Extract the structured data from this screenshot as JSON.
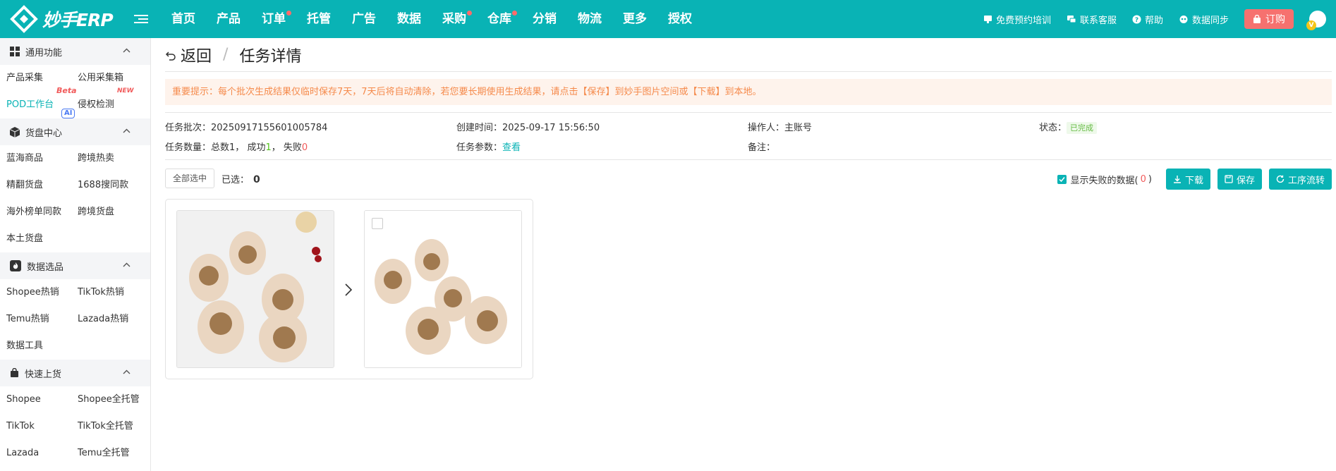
{
  "app": {
    "logo_text": "妙手ERP"
  },
  "nav": {
    "items": [
      {
        "label": "首页",
        "dot": false
      },
      {
        "label": "产品",
        "dot": false
      },
      {
        "label": "订单",
        "dot": true
      },
      {
        "label": "托管",
        "dot": false
      },
      {
        "label": "广告",
        "dot": false
      },
      {
        "label": "数据",
        "dot": false
      },
      {
        "label": "采购",
        "dot": true
      },
      {
        "label": "仓库",
        "dot": true
      },
      {
        "label": "分销",
        "dot": false
      },
      {
        "label": "物流",
        "dot": false
      },
      {
        "label": "更多",
        "dot": false
      },
      {
        "label": "授权",
        "dot": false
      }
    ]
  },
  "top_right": {
    "training": "免费预约培训",
    "support": "联系客服",
    "help": "帮助",
    "sync": "数据同步",
    "buy": "订购",
    "avatar_badge": "V"
  },
  "sidebar": {
    "sections": [
      {
        "title": "通用功能",
        "items": [
          {
            "label": "产品采集"
          },
          {
            "label": "公用采集箱"
          },
          {
            "label": "POD工作台",
            "tag": "Beta",
            "active": true
          },
          {
            "label": "侵权检测",
            "tag": "NEW",
            "tag2": "AI"
          }
        ]
      },
      {
        "title": "货盘中心",
        "items": [
          {
            "label": "蓝海商品"
          },
          {
            "label": "跨境热卖"
          },
          {
            "label": "精翻货盘"
          },
          {
            "label": "1688搜同款"
          },
          {
            "label": "海外榜单同款"
          },
          {
            "label": "跨境货盘"
          },
          {
            "label": "本土货盘"
          }
        ]
      },
      {
        "title": "数据选品",
        "items": [
          {
            "label": "Shopee热销"
          },
          {
            "label": "TikTok热销"
          },
          {
            "label": "Temu热销"
          },
          {
            "label": "Lazada热销"
          },
          {
            "label": "数据工具"
          }
        ]
      },
      {
        "title": "快速上货",
        "items": [
          {
            "label": "Shopee"
          },
          {
            "label": "Shopee全托管"
          },
          {
            "label": "TikTok"
          },
          {
            "label": "TikTok全托管"
          },
          {
            "label": "Lazada"
          },
          {
            "label": "Temu全托管"
          }
        ]
      }
    ]
  },
  "page": {
    "back": "返回",
    "separator": "/",
    "title": "任务详情",
    "notice": "重要提示：每个批次生成结果仅临时保存7天，7天后将自动清除，若您要长期使用生成结果，请点击【保存】到妙手图片空间或【下载】到本地。"
  },
  "info": {
    "batch_label": "任务批次：",
    "batch_value": "20250917155601005784",
    "created_label": "创建时间：",
    "created_value": "2025-09-17 15:56:50",
    "operator_label": "操作人：",
    "operator_value": "主账号",
    "status_label": "状态：",
    "status_value": "已完成",
    "count_label": "任务数量：",
    "count_total": "总数1，",
    "count_success_label": "成功",
    "count_success": "1",
    "count_sep": "，",
    "count_fail_label": "失败",
    "count_fail": "0",
    "params_label": "任务参数：",
    "params_link": "查看",
    "remark_label": "备注："
  },
  "toolbar": {
    "select_all": "全部选中",
    "selected_label": "已选：",
    "selected_count": "0",
    "show_failed": "显示失败的数据(",
    "failed_count": "0",
    "show_failed_close": ")",
    "download": "下载",
    "save": "保存",
    "workflow": "工序流转"
  },
  "colors": {
    "brand": "#09b3b5",
    "notice_bg": "#fef3ec",
    "notice_text": "#f58a4b",
    "danger": "#f15a5a",
    "buy_button": "#f6716f"
  }
}
